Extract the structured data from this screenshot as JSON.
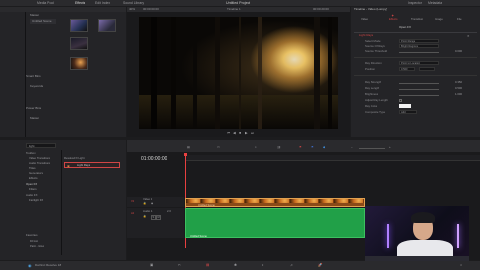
{
  "titlebar": {
    "tabs": [
      {
        "label": "Media Pool"
      },
      {
        "label": "Effects"
      },
      {
        "label": "Edit Index"
      },
      {
        "label": "Sound Library"
      }
    ],
    "project": "Untitled Project",
    "right_tabs": [
      {
        "label": "Inspector"
      },
      {
        "label": "Metadata"
      }
    ]
  },
  "viewer": {
    "zoom": "40%",
    "timecode": "00:00:00:00",
    "timeline_name": "Timeline 1",
    "duration": "00:00:20:00"
  },
  "media_pool": {
    "root": "Master",
    "items": [
      {
        "label": "Untitled Scene"
      }
    ],
    "thumb_labels": [
      "",
      "",
      ""
    ],
    "smart_bins_label": "Smart Bins",
    "keywords_label": "Keywords",
    "power_bins_label": "Power Bins",
    "master_label": "Master"
  },
  "inspector": {
    "title": "Timeline - Video (Lumpy)",
    "tabs": [
      {
        "label": "Video"
      },
      {
        "label": "Effects"
      },
      {
        "label": "Transition"
      },
      {
        "label": "Image"
      },
      {
        "label": "File"
      }
    ],
    "sub_tab": "Open FX",
    "section": "Light Rays",
    "fields": [
      {
        "label": "Select Mode",
        "value": "Point Range"
      },
      {
        "label": "Source Of Rays",
        "value": "Bright Regions"
      },
      {
        "label": "Source Threshold",
        "value": "0.000"
      },
      {
        "label": "Ray Direction",
        "value": "Point to Location"
      },
      {
        "label": "Position",
        "value": "0.500"
      },
      {
        "label": "Ray Strength",
        "value": "0.350"
      },
      {
        "label": "Ray Length",
        "value": "0.500"
      },
      {
        "label": "Brightness",
        "value": "1.000"
      },
      {
        "label": "Blend",
        "value": "0.000"
      },
      {
        "label": "Composite Type",
        "value": "Add"
      }
    ],
    "extra": [
      "Adjust Ray Length",
      "Use Color",
      "Ray Color"
    ]
  },
  "effects": {
    "search_placeholder": "light",
    "tree": [
      {
        "label": "Toolbox"
      },
      {
        "label": "Video Transitions"
      },
      {
        "label": "Audio Transitions"
      },
      {
        "label": "Titles"
      },
      {
        "label": "Generators"
      },
      {
        "label": "Effects"
      },
      {
        "label": "Open FX"
      },
      {
        "label": "Filters"
      },
      {
        "label": "Audio FX"
      },
      {
        "label": "Fairlight FX"
      }
    ],
    "favorites_label": "Favorites",
    "favorites": [
      {
        "label": "Fill List"
      },
      {
        "label": "Paint - Glow"
      }
    ],
    "category": "ResolveFX Light",
    "result": "Light Rays"
  },
  "timeline": {
    "timecode": "01:00:00:00",
    "tracks": [
      {
        "label": "Video 1",
        "id": "V1"
      },
      {
        "label": "Audio 1",
        "id": "A1",
        "extra": "2.0"
      }
    ],
    "clip_count": 12,
    "video_clip": "Untitled Scene",
    "audio_clip": "Untitled Scene"
  },
  "bottom_bar": {
    "app": "DaVinci Resolve 18"
  },
  "colors": {
    "accent_red": "#d04545",
    "clip_orange": "#c86a1e",
    "audio_green": "#21a048",
    "playhead": "#e84040"
  }
}
